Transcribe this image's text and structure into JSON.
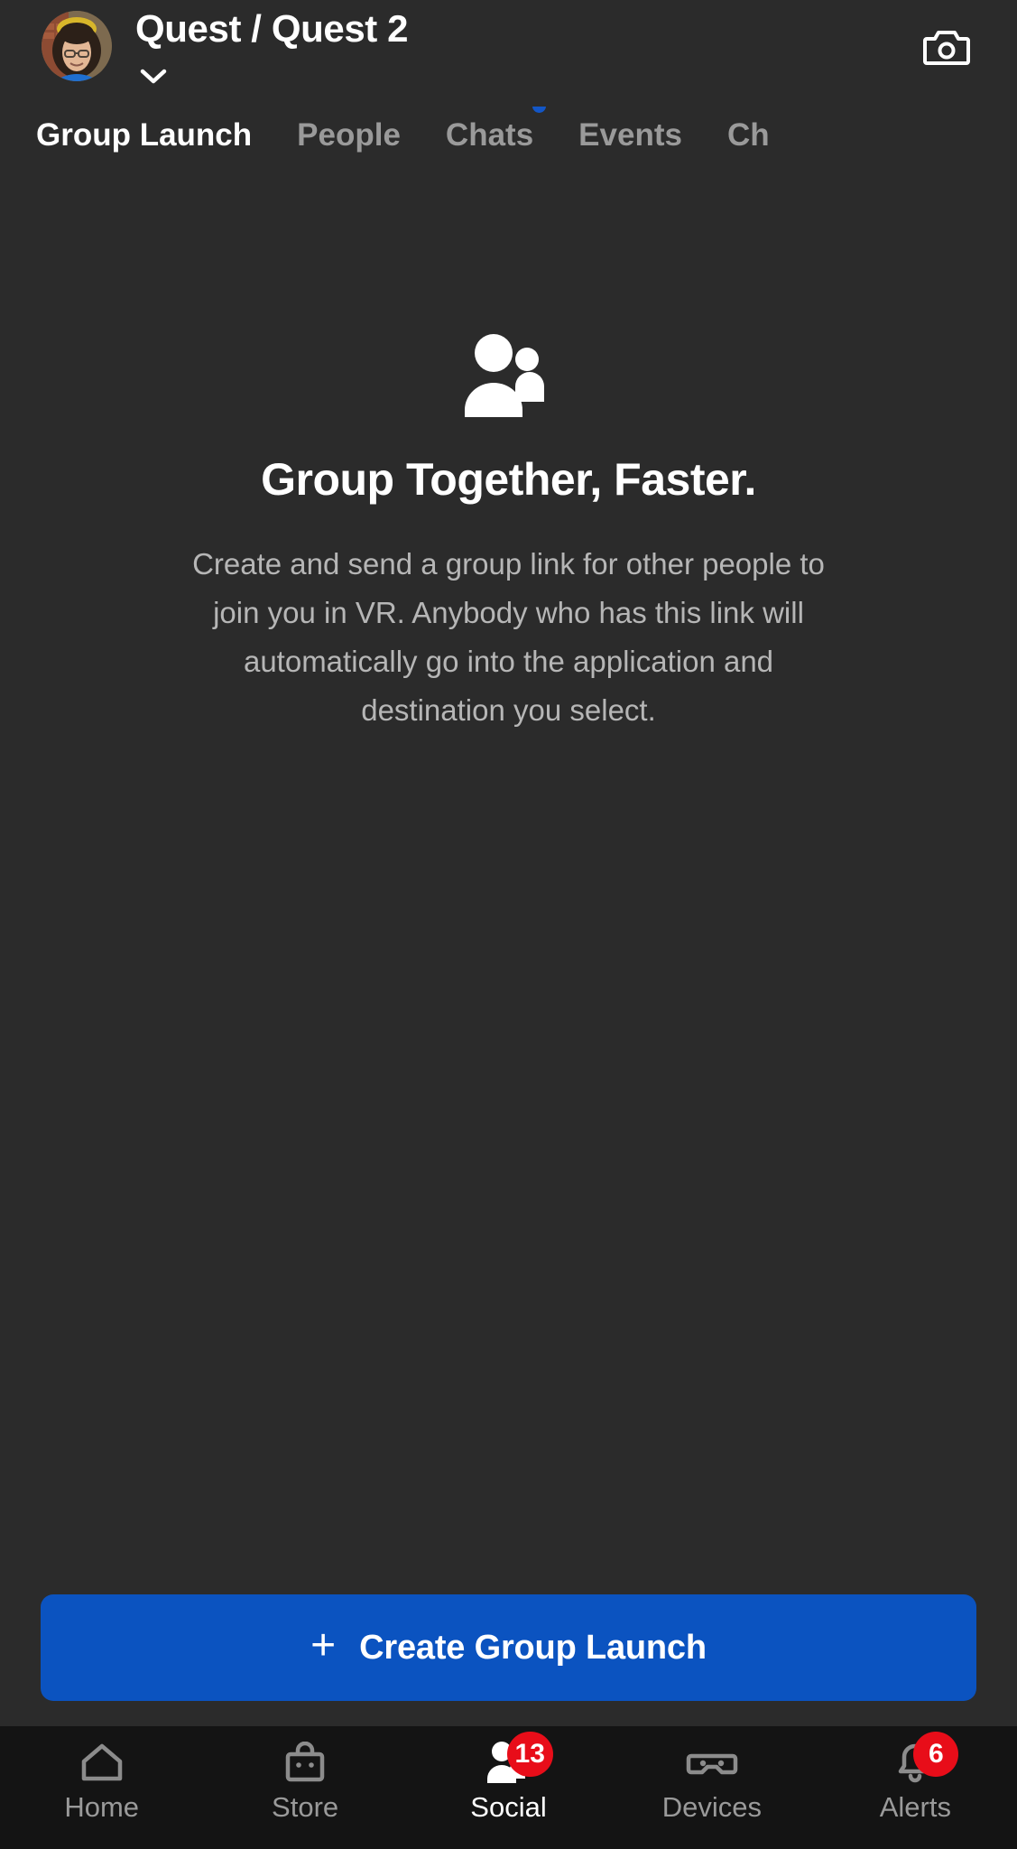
{
  "header": {
    "title": "Quest / Quest 2",
    "avatar_icon": "user-avatar-photo",
    "chevron_icon": "chevron-down-icon",
    "camera_icon": "camera-icon"
  },
  "tabs": [
    {
      "label": "Group Launch",
      "active": true,
      "dot": false
    },
    {
      "label": "People",
      "active": false,
      "dot": false
    },
    {
      "label": "Chats",
      "active": false,
      "dot": true
    },
    {
      "label": "Events",
      "active": false,
      "dot": false
    },
    {
      "label": "Ch",
      "active": false,
      "dot": false
    }
  ],
  "empty_state": {
    "icon": "people-group-icon",
    "title": "Group Together, Faster.",
    "body": "Create and send a group link for other people to join you in VR. Anybody who has this link will automatically go into the application and destination you select."
  },
  "cta": {
    "plus_icon": "plus-icon",
    "label": "Create Group Launch",
    "color": "#0b53c0"
  },
  "bottom_nav": [
    {
      "label": "Home",
      "icon": "home-icon",
      "active": false,
      "badge": null
    },
    {
      "label": "Store",
      "icon": "store-bag-icon",
      "active": false,
      "badge": null
    },
    {
      "label": "Social",
      "icon": "people-icon",
      "active": true,
      "badge": "13"
    },
    {
      "label": "Devices",
      "icon": "vr-headset-icon",
      "active": false,
      "badge": null
    },
    {
      "label": "Alerts",
      "icon": "bell-icon",
      "active": false,
      "badge": "6"
    }
  ],
  "colors": {
    "background": "#2b2b2b",
    "nav_background": "#141414",
    "accent_blue": "#0b53c0",
    "dot_blue": "#1356c6",
    "badge_red": "#e80d19",
    "text_primary": "#ffffff",
    "text_secondary": "#9a9a9a",
    "text_body": "#b6b6b6"
  }
}
